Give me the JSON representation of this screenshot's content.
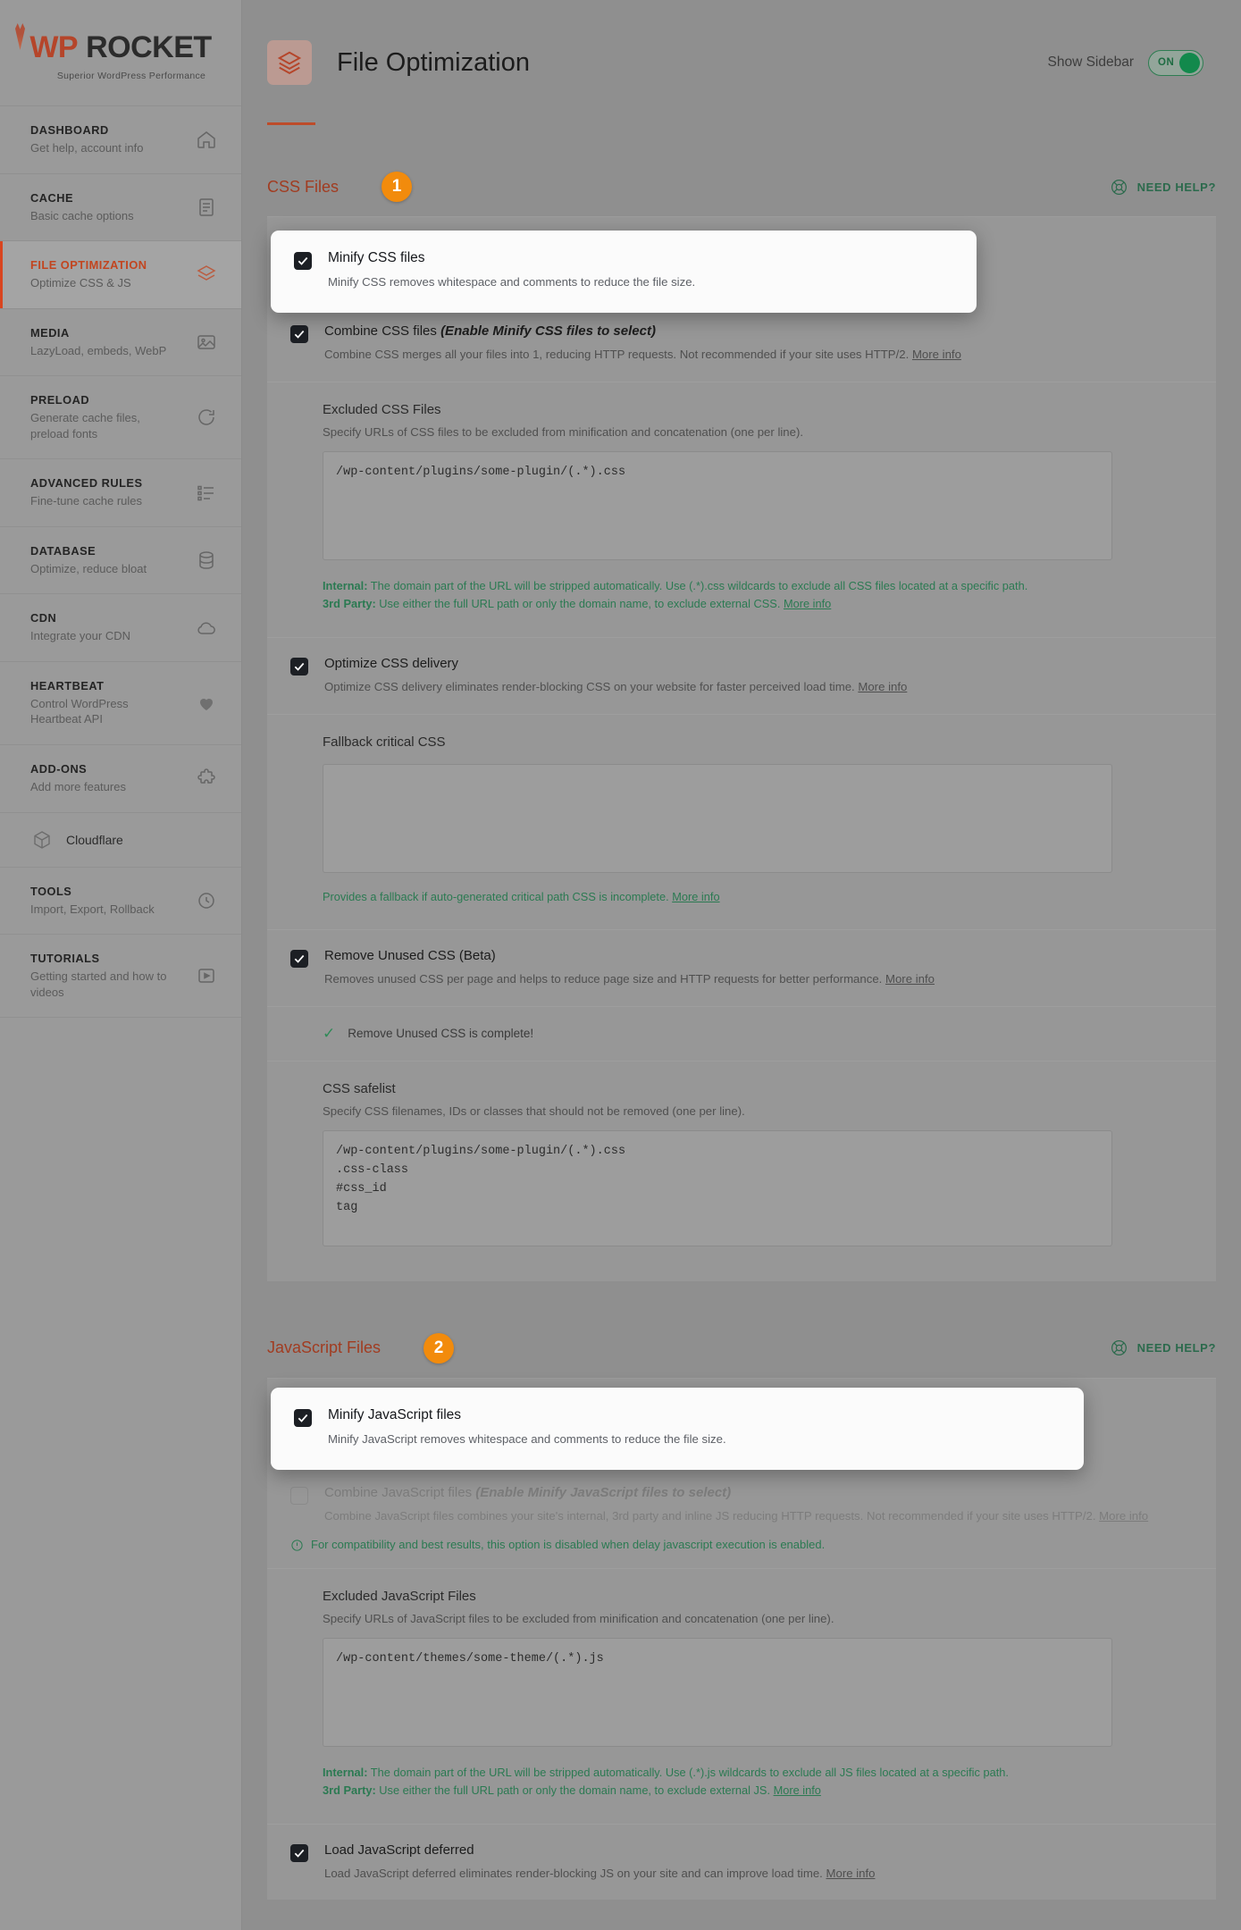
{
  "brand": {
    "logo_wp": "WP",
    "logo_rocket": "ROCKET",
    "tagline": "Superior WordPress Performance"
  },
  "sidebar": {
    "items": [
      {
        "title": "DASHBOARD",
        "sub": "Get help, account info",
        "icon": "home-icon",
        "active": false
      },
      {
        "title": "CACHE",
        "sub": "Basic cache options",
        "icon": "document-icon",
        "active": false
      },
      {
        "title": "FILE OPTIMIZATION",
        "sub": "Optimize CSS & JS",
        "icon": "layers-icon",
        "active": true
      },
      {
        "title": "MEDIA",
        "sub": "LazyLoad, embeds, WebP",
        "icon": "image-icon",
        "active": false
      },
      {
        "title": "PRELOAD",
        "sub": "Generate cache files, preload fonts",
        "icon": "refresh-icon",
        "active": false
      },
      {
        "title": "ADVANCED RULES",
        "sub": "Fine-tune cache rules",
        "icon": "list-icon",
        "active": false
      },
      {
        "title": "DATABASE",
        "sub": "Optimize, reduce bloat",
        "icon": "database-icon",
        "active": false
      },
      {
        "title": "CDN",
        "sub": "Integrate your CDN",
        "icon": "cloud-icon",
        "active": false
      },
      {
        "title": "HEARTBEAT",
        "sub": "Control WordPress Heartbeat API",
        "icon": "heart-pulse-icon",
        "active": false
      },
      {
        "title": "ADD-ONS",
        "sub": "Add more features",
        "icon": "puzzle-icon",
        "active": false
      }
    ],
    "simple_item": {
      "title": "Cloudflare",
      "icon": "cube-icon"
    },
    "items_tail": [
      {
        "title": "TOOLS",
        "sub": "Import, Export, Rollback",
        "icon": "tools-icon",
        "active": false
      },
      {
        "title": "TUTORIALS",
        "sub": "Getting started and how to videos",
        "icon": "video-icon",
        "active": false
      }
    ]
  },
  "header": {
    "icon": "layers-icon",
    "title": "File Optimization",
    "show_sidebar_label": "Show Sidebar",
    "toggle_state": "ON"
  },
  "css_section": {
    "title": "CSS Files",
    "badge": "1",
    "need_help": "NEED HELP?",
    "minify": {
      "label": "Minify CSS files",
      "desc": "Minify CSS removes whitespace and comments to reduce the file size.",
      "checked": true
    },
    "combine": {
      "label": "Combine CSS files ",
      "hint": "(Enable Minify CSS files to select)",
      "desc": "Combine CSS merges all your files into 1, reducing HTTP requests. Not recommended if your site uses HTTP/2. ",
      "more_info": "More info",
      "checked": true
    },
    "excluded": {
      "label": "Excluded CSS Files",
      "desc": "Specify URLs of CSS files to be excluded from minification and concatenation (one per line).",
      "value": "/wp-content/plugins/some-plugin/(.*).css",
      "note_internal_label": "Internal:",
      "note_internal": " The domain part of the URL will be stripped automatically. Use (.*).css wildcards to exclude all CSS files located at a specific path.",
      "note_third_label": "3rd Party:",
      "note_third": " Use either the full URL path or only the domain name, to exclude external CSS. ",
      "note_more_info": "More info"
    },
    "optimize_delivery": {
      "label": "Optimize CSS delivery",
      "desc": "Optimize CSS delivery eliminates render-blocking CSS on your website for faster perceived load time. ",
      "more_info": "More info",
      "checked": true
    },
    "fallback": {
      "label": "Fallback critical CSS",
      "value": "",
      "note": "Provides a fallback if auto-generated critical path CSS is incomplete. ",
      "note_more_info": "More info"
    },
    "remove_unused": {
      "label": "Remove Unused CSS (Beta)",
      "desc": "Removes unused CSS per page and helps to reduce page size and HTTP requests for better performance. ",
      "more_info": "More info",
      "checked": true,
      "status": "Remove Unused CSS is complete!"
    },
    "safelist": {
      "label": "CSS safelist",
      "desc": "Specify CSS filenames, IDs or classes that should not be removed (one per line).",
      "value": "/wp-content/plugins/some-plugin/(.*).css\n.css-class\n#css_id\ntag"
    }
  },
  "js_section": {
    "title": "JavaScript Files",
    "badge": "2",
    "need_help": "NEED HELP?",
    "minify": {
      "label": "Minify JavaScript files",
      "desc": "Minify JavaScript removes whitespace and comments to reduce the file size.",
      "checked": true
    },
    "combine": {
      "label": "Combine JavaScript files ",
      "hint": "(Enable Minify JavaScript files to select)",
      "desc": "Combine JavaScript files combines your site's internal, 3rd party and inline JS reducing HTTP requests. Not recommended if your site uses HTTP/2. ",
      "more_info": "More info",
      "checked": false,
      "warning": "For compatibility and best results, this option is disabled when delay javascript execution is enabled."
    },
    "excluded": {
      "label": "Excluded JavaScript Files",
      "desc": "Specify URLs of JavaScript files to be excluded from minification and concatenation (one per line).",
      "value": "/wp-content/themes/some-theme/(.*).js",
      "note_internal_label": "Internal:",
      "note_internal": " The domain part of the URL will be stripped automatically. Use (.*).js wildcards to exclude all JS files located at a specific path.",
      "note_third_label": "3rd Party:",
      "note_third": " Use either the full URL path or only the domain name, to exclude external JS. ",
      "note_more_info": "More info"
    },
    "defer": {
      "label": "Load JavaScript deferred",
      "desc": "Load JavaScript deferred eliminates render-blocking JS on your site and can improve load time. ",
      "more_info": "More info",
      "checked": true
    }
  },
  "colors": {
    "brand_red": "#b5452a",
    "accent_orange": "#f28b0c",
    "green": "#2b7a52",
    "toggle_green": "#12894c"
  }
}
